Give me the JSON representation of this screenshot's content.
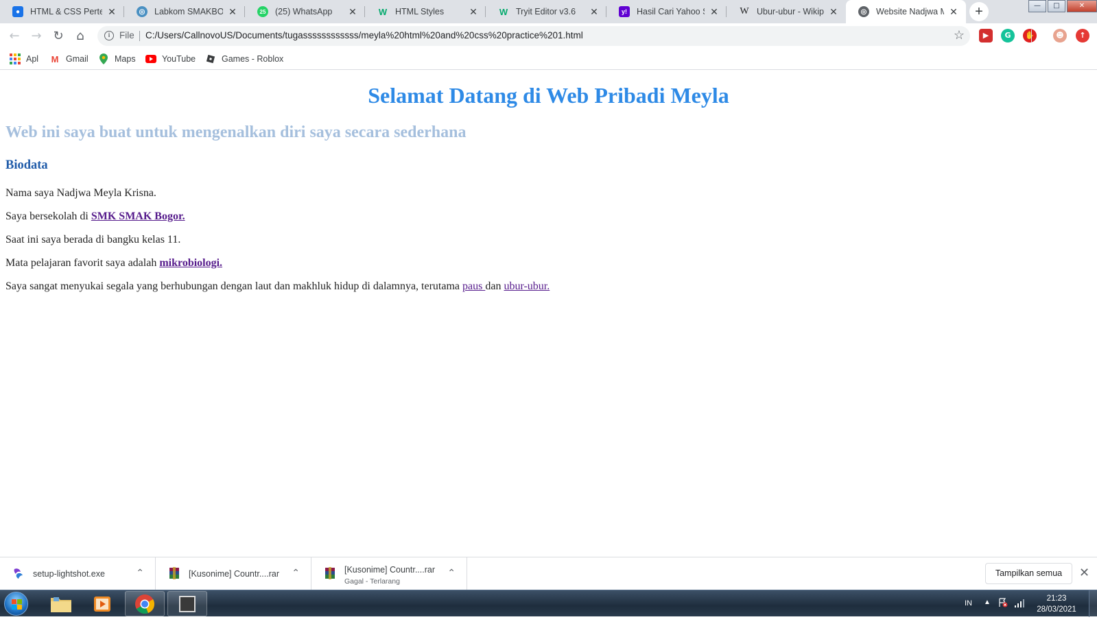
{
  "tabs": [
    {
      "title": "HTML & CSS Pertem",
      "icon": "classroom-icon",
      "color": "#1a73e8"
    },
    {
      "title": "Labkom SMAKBO - H",
      "icon": "globe-icon",
      "color": "#4a90c2"
    },
    {
      "title": "(25) WhatsApp",
      "icon": "whatsapp-icon",
      "color": "#25d366",
      "badge": "25"
    },
    {
      "title": "HTML Styles",
      "icon": "w3schools-icon",
      "color": "#04aa6d"
    },
    {
      "title": "Tryit Editor v3.6",
      "icon": "w3schools-icon",
      "color": "#04aa6d"
    },
    {
      "title": "Hasil Cari Yahoo Sea",
      "icon": "yahoo-icon",
      "color": "#6001d2"
    },
    {
      "title": "Ubur-ubur - Wikiped",
      "icon": "wikipedia-icon",
      "color": "#202122"
    },
    {
      "title": "Website Nadjwa Me",
      "icon": "globe-icon",
      "color": "#5f6368",
      "active": true
    }
  ],
  "address": {
    "scheme_label": "File",
    "url": "C:/Users/CallnovoUS/Documents/tugassssssssssss/meyla%20html%20and%20css%20practice%201.html"
  },
  "bookmarks": [
    {
      "label": "Apl",
      "icon": "apps-grid-icon"
    },
    {
      "label": "Gmail",
      "icon": "gmail-icon"
    },
    {
      "label": "Maps",
      "icon": "maps-pin-icon"
    },
    {
      "label": "YouTube",
      "icon": "youtube-icon"
    },
    {
      "label": "Games - Roblox",
      "icon": "roblox-icon"
    }
  ],
  "page": {
    "heading": "Selamat Datang di Web Pribadi Meyla",
    "subheading": "Web ini saya buat untuk mengenalkan diri saya secara sederhana",
    "section_title": "Biodata",
    "p1": "Nama saya Nadjwa Meyla Krisna.",
    "p2_prefix": "Saya bersekolah di ",
    "p2_link": "SMK SMAK Bogor.",
    "p3": "Saat ini saya berada di bangku kelas 11.",
    "p4_prefix": "Mata pelajaran favorit saya adalah ",
    "p4_link": "mikrobiologi.",
    "p5_prefix": "Saya sangat menyukai segala yang berhubungan dengan laut dan makhluk hidup di dalamnya, terutama ",
    "p5_link1": "paus ",
    "p5_mid": "dan ",
    "p5_link2": "ubur-ubur.",
    "colors": {
      "heading": "#2e8ae6",
      "subheading": "#a5bfdd",
      "section": "#1f5ba9",
      "link": "#551a8b"
    }
  },
  "downloads": [
    {
      "name": "setup-lightshot.exe",
      "status": ""
    },
    {
      "name": "[Kusonime] Countr....rar",
      "status": ""
    },
    {
      "name": "[Kusonime] Countr....rar",
      "status": "Gagal - Terlarang"
    }
  ],
  "shelf": {
    "show_all_label": "Tampilkan semua"
  },
  "taskbar": {
    "language": "IN",
    "time": "21:23",
    "date": "28/03/2021"
  }
}
